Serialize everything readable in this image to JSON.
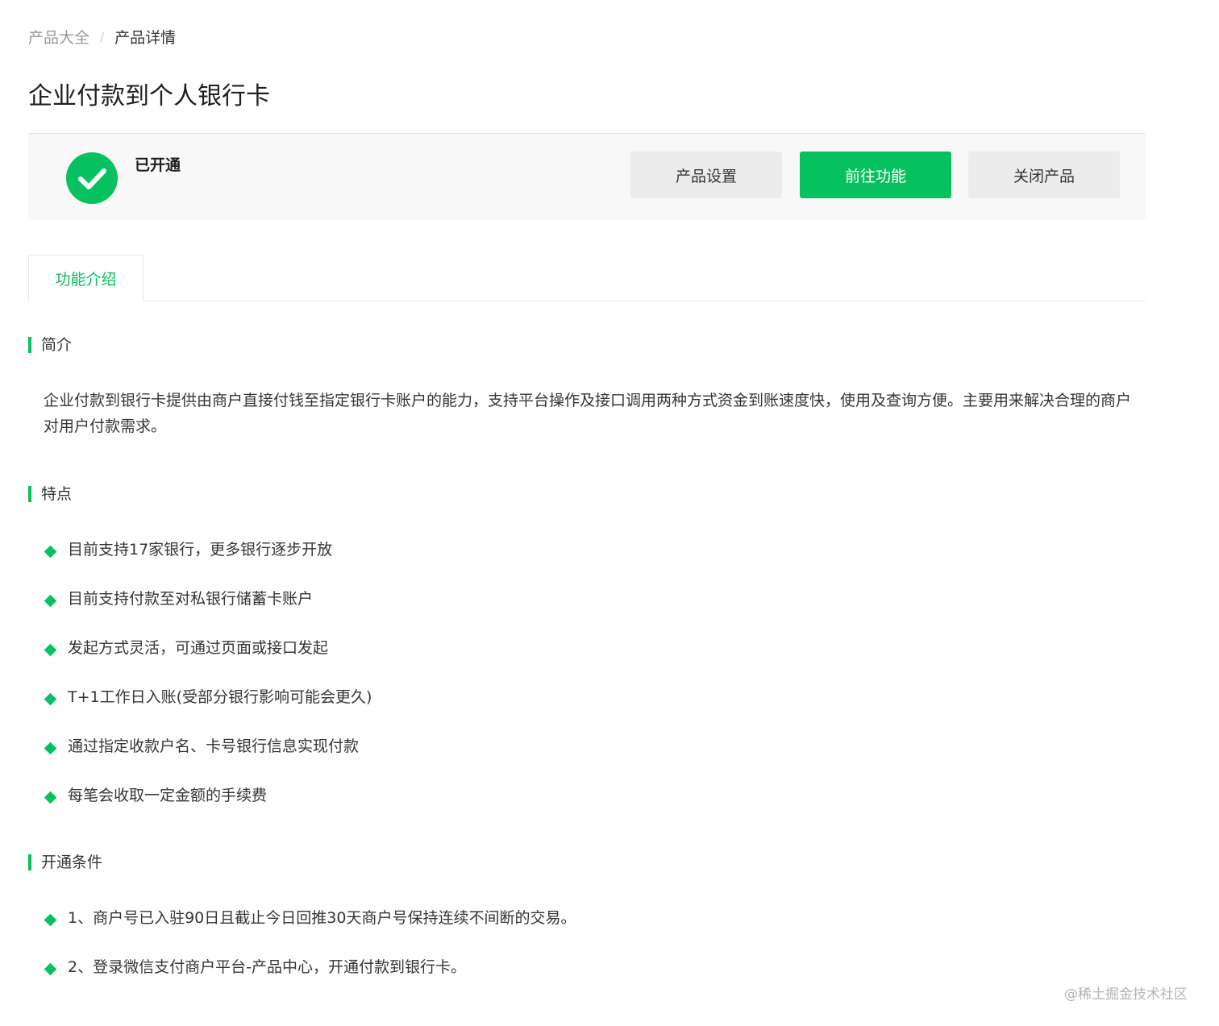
{
  "breadcrumb": {
    "parent": "产品大全",
    "separator": "/",
    "current": "产品详情"
  },
  "page_title": "企业付款到个人银行卡",
  "status": {
    "text": "已开通",
    "icon": "check-circle-icon",
    "color": "#07c160"
  },
  "actions": {
    "settings": "产品设置",
    "goto": "前往功能",
    "close": "关闭产品"
  },
  "tabs": [
    {
      "label": "功能介绍",
      "active": true
    }
  ],
  "sections": {
    "intro": {
      "title": "简介",
      "text": "企业付款到银行卡提供由商户直接付钱至指定银行卡账户的能力，支持平台操作及接口调用两种方式资金到账速度快，使用及查询方便。主要用来解决合理的商户对用户付款需求。"
    },
    "features": {
      "title": "特点",
      "items": [
        "目前支持17家银行，更多银行逐步开放",
        "目前支持付款至对私银行储蓄卡账户",
        "发起方式灵活，可通过页面或接口发起",
        "T+1工作日入账(受部分银行影响可能会更久)",
        "通过指定收款户名、卡号银行信息实现付款",
        "每笔会收取一定金额的手续费"
      ]
    },
    "conditions": {
      "title": "开通条件",
      "items": [
        "1、商户号已入驻90日且截止今日回推30天商户号保持连续不间断的交易。",
        "2、登录微信支付商户平台-产品中心，开通付款到银行卡。"
      ]
    }
  },
  "watermark": "@稀土掘金技术社区",
  "accent_color": "#07c160"
}
